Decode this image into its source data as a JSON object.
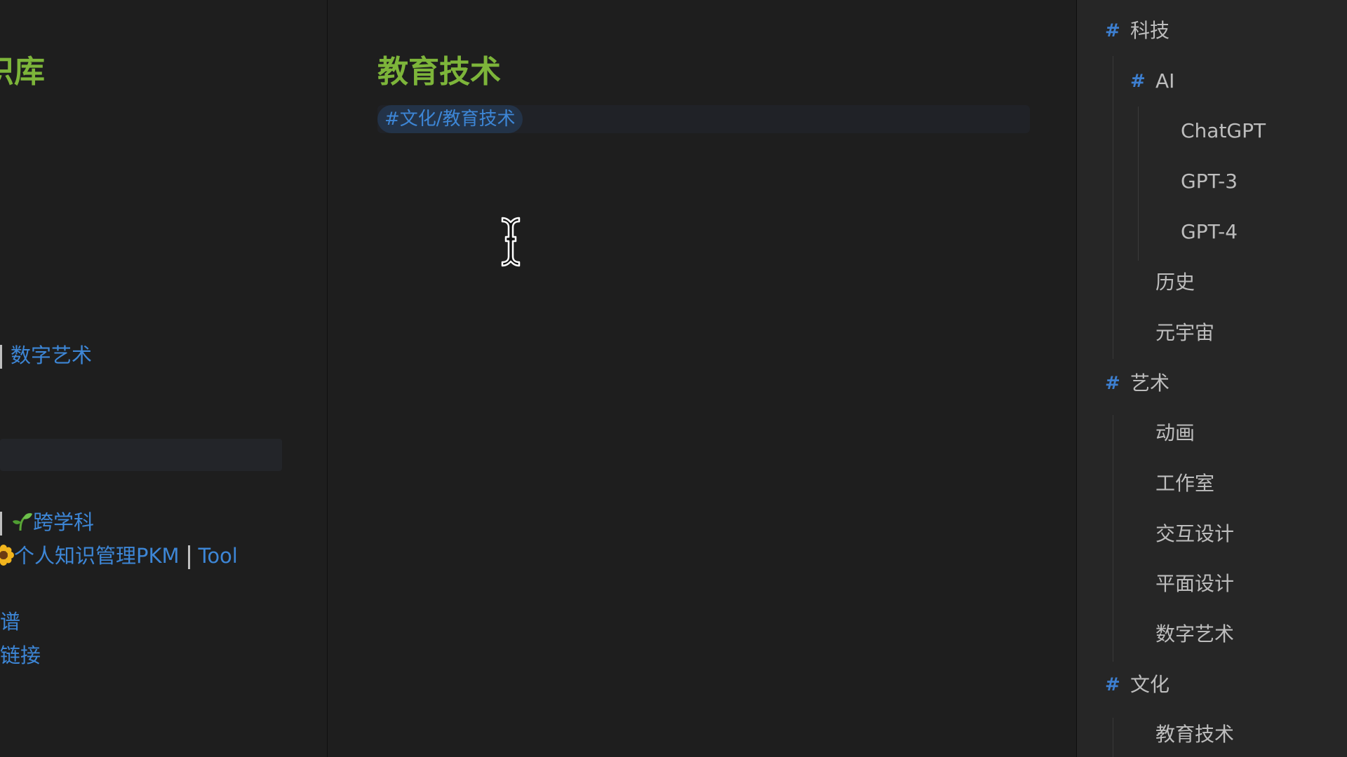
{
  "left_pane": {
    "title_fragment": "识库",
    "link_digital_art": "数字艺术",
    "link_interdisciplinary": "跨学科",
    "link_pkm": "个人知识管理PKM",
    "link_tool": "Tool",
    "line_fragment_1": "谱",
    "line_fragment_2": "链接"
  },
  "note": {
    "title": "教育技术",
    "tag": "#文化/教育技术"
  },
  "tag_tree": {
    "tech": "科技",
    "ai": "AI",
    "chatgpt": "ChatGPT",
    "gpt3": "GPT-3",
    "gpt4": "GPT-4",
    "history": "历史",
    "metaverse": "元宇宙",
    "art": "艺术",
    "animation": "动画",
    "studio": "工作室",
    "interaction_design": "交互设计",
    "graphic_design": "平面设计",
    "digital_art": "数字艺术",
    "culture": "文化",
    "edtech": "教育技术",
    "hash_glyph": "#"
  },
  "colors": {
    "heading_green": "#7db53a",
    "link_blue": "#3d86d6",
    "tag_hash_blue": "#3d7fd0",
    "background": "#1e1e1e",
    "sidebar_bg": "#262626"
  },
  "icons": {
    "cursor": "text-cursor-icon",
    "hash": "hash-icon",
    "seedling": "seedling-icon",
    "sunflower": "sunflower-icon"
  }
}
